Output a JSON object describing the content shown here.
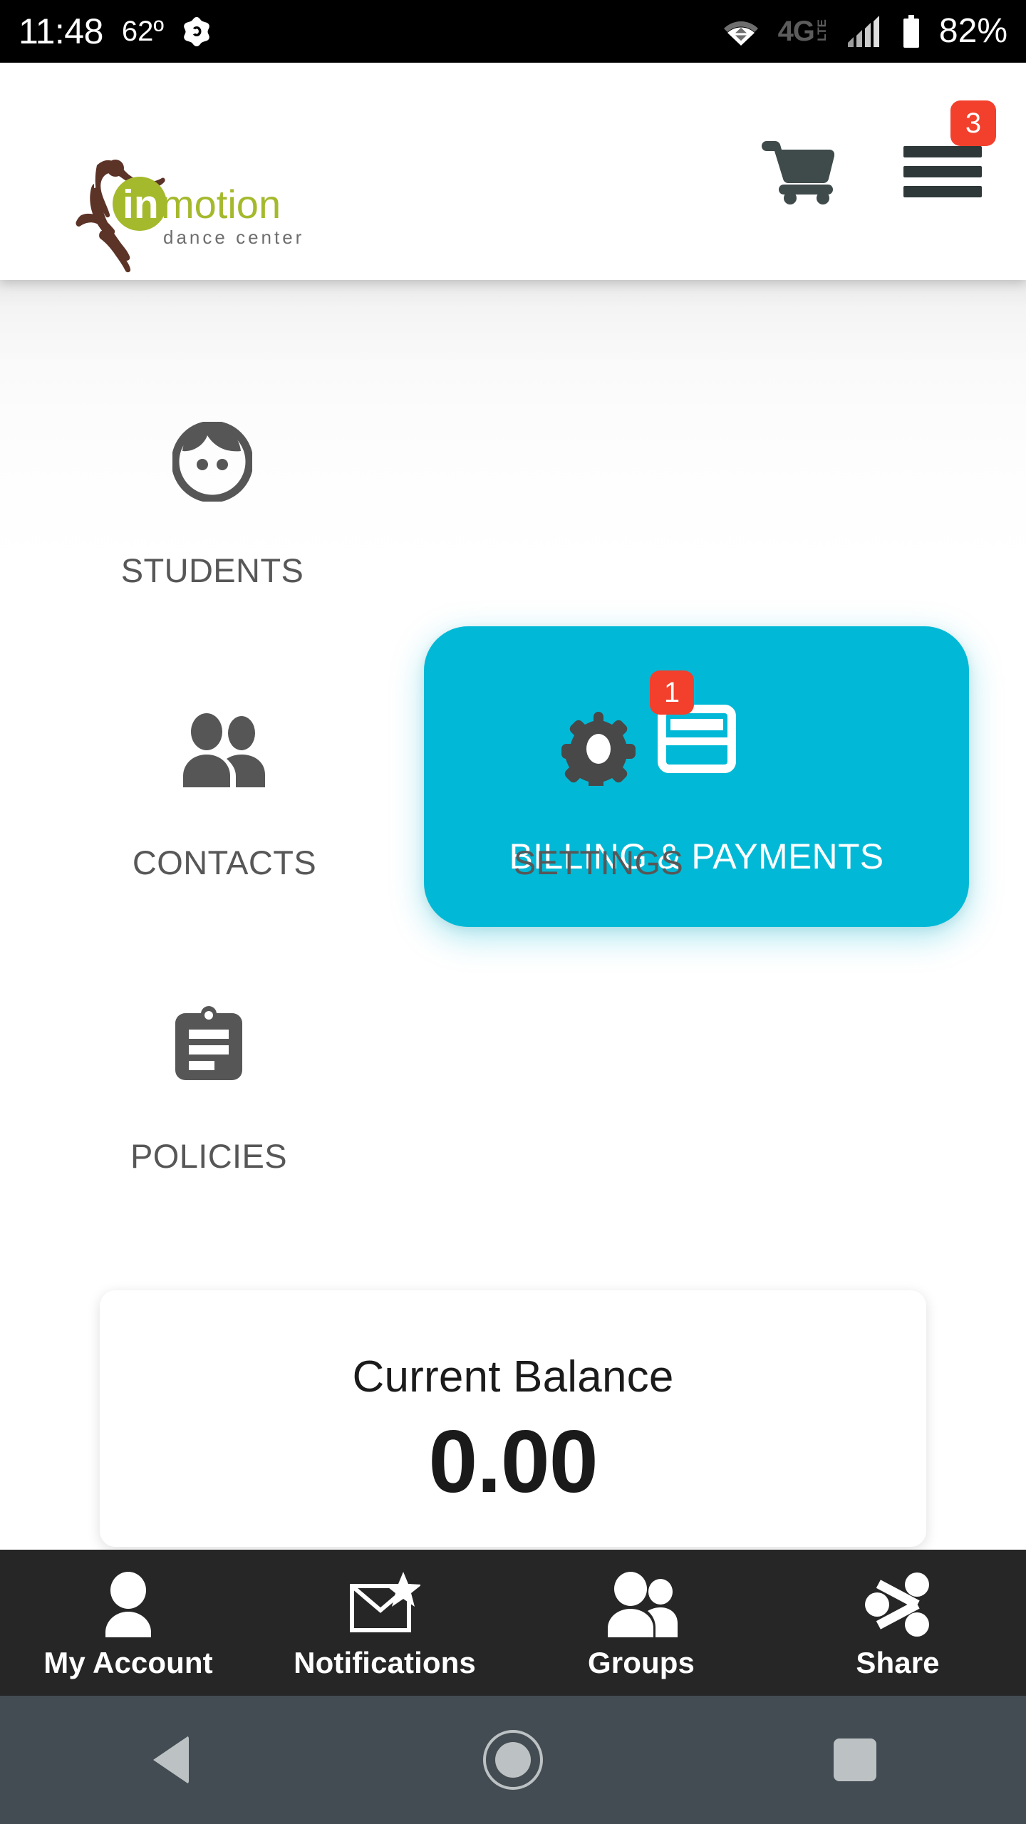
{
  "status_bar": {
    "time": "11:48",
    "temperature": "62º",
    "network_type": "4G",
    "network_suffix": "LTE",
    "battery_percent": "82%",
    "icons": [
      "app-notification-icon",
      "wifi-icon",
      "cellular-signal-icon",
      "battery-icon"
    ]
  },
  "header": {
    "logo": {
      "word_mark_in": "in",
      "word_mark_motion": "motion",
      "tagline": "dance center",
      "dancer_color": "#5c3327",
      "accent_color": "#a5b92c",
      "tagline_color": "#6e6e6e"
    },
    "cart_icon": "shopping-cart-icon",
    "menu_icon": "hamburger-menu-icon",
    "menu_badge_count": "3"
  },
  "dashboard": {
    "tiles": [
      {
        "id": "students",
        "label": "STUDENTS",
        "icon": "student-face-icon",
        "badge": null,
        "highlighted": false
      },
      {
        "id": "billing",
        "label": "BILLING & PAYMENTS",
        "icon": "credit-card-icon",
        "badge": null,
        "highlighted": true
      },
      {
        "id": "contacts",
        "label": "CONTACTS",
        "icon": "two-people-icon",
        "badge": null,
        "highlighted": false
      },
      {
        "id": "settings",
        "label": "SETTINGS",
        "icon": "gear-icon",
        "badge": "1",
        "highlighted": false
      },
      {
        "id": "policies",
        "label": "POLICIES",
        "icon": "clipboard-icon",
        "badge": null,
        "highlighted": false
      }
    ],
    "highlight_color": "#01b9d6",
    "badge_color": "#F2402D",
    "label_color": "#575757"
  },
  "balance_card": {
    "title": "Current Balance",
    "value": "0.00"
  },
  "tab_bar": {
    "items": [
      {
        "id": "my-account",
        "label": "My Account",
        "icon": "person-icon"
      },
      {
        "id": "notifications",
        "label": "Notifications",
        "icon": "envelope-star-icon"
      },
      {
        "id": "groups",
        "label": "Groups",
        "icon": "group-people-icon"
      },
      {
        "id": "share",
        "label": "Share",
        "icon": "share-nodes-icon"
      }
    ],
    "background_color": "#262626"
  },
  "system_nav": {
    "back": "back-nav-button",
    "home": "home-nav-button",
    "recents": "recents-nav-button",
    "background_color": "#434c52"
  }
}
